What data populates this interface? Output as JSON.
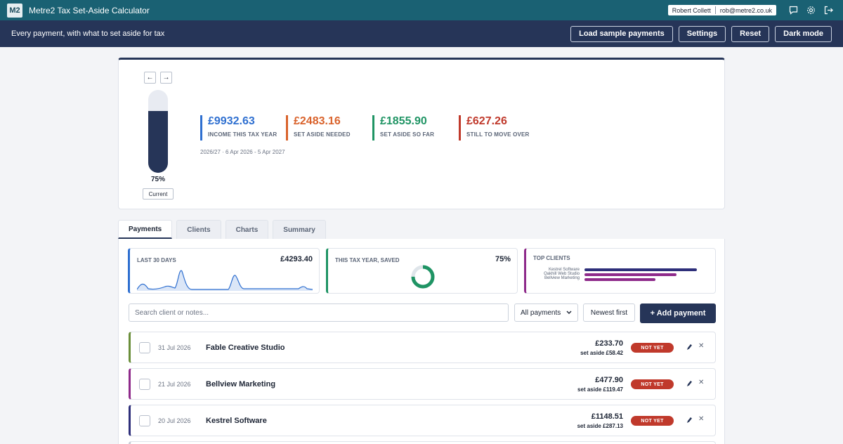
{
  "app": {
    "logo": "M2",
    "title": "Metre2 Tax Set-Aside Calculator"
  },
  "user": {
    "name": "Robert Collett",
    "email": "rob@metre2.co.uk"
  },
  "top_icons": [
    "chat-icon",
    "gear-icon",
    "logout-icon"
  ],
  "subbar": {
    "tagline": "Every payment, with what to set aside for tax",
    "buttons": [
      "Load sample payments",
      "Settings",
      "Reset",
      "Dark mode"
    ]
  },
  "hero": {
    "prev": "←",
    "next": "→",
    "jar_fraction": 0.75,
    "jar_label": "75%",
    "current_label": "Current",
    "stats": [
      {
        "value": "£9932.63",
        "label": "INCOME THIS TAX YEAR",
        "color": "#2e6fd0"
      },
      {
        "value": "£2483.16",
        "label": "SET ASIDE NEEDED",
        "color": "#d9622b"
      },
      {
        "value": "£1855.90",
        "label": "SET ASIDE SO FAR",
        "color": "#1f9464"
      },
      {
        "value": "£627.26",
        "label": "STILL TO MOVE OVER",
        "color": "#c0392b"
      }
    ],
    "period": "2026/27 · 6 Apr 2026 - 5 Apr 2027"
  },
  "tabs": [
    "Payments",
    "Clients",
    "Charts",
    "Summary"
  ],
  "cards": {
    "last30": {
      "title": "LAST 30 DAYS",
      "value": "£4293.40",
      "color": "#2e6fd0"
    },
    "saved": {
      "title": "THIS TAX YEAR, SAVED",
      "value": "75%",
      "fraction": 0.75,
      "color": "#1f9464"
    },
    "top_clients": {
      "title": "TOP CLIENTS",
      "color": "#8e2a8a",
      "clients": [
        {
          "name": "Kestrel Software",
          "share": 1.0,
          "color": "#2e2f7a"
        },
        {
          "name": "Oakhill Web Studio",
          "share": 0.82,
          "color": "#8e2a8a"
        },
        {
          "name": "Bellview Marketing",
          "share": 0.63,
          "color": "#8e2a8a"
        }
      ]
    }
  },
  "toolbar": {
    "search_placeholder": "Search client or notes...",
    "filter": "All payments",
    "sort": "Newest first",
    "add": "+ Add payment"
  },
  "payments": [
    {
      "date": "31 Jul 2026",
      "client": "Fable Creative Studio",
      "amount": "£233.70",
      "aside": "set aside £58.42",
      "status": "NOT YET",
      "color": "#6a8e3a"
    },
    {
      "date": "21 Jul 2026",
      "client": "Bellview Marketing",
      "amount": "£477.90",
      "aside": "set aside £119.47",
      "status": "NOT YET",
      "color": "#8e2a8a"
    },
    {
      "date": "20 Jul 2026",
      "client": "Kestrel Software",
      "amount": "£1148.51",
      "aside": "set aside £287.13",
      "status": "NOT YET",
      "color": "#2e2f7a"
    }
  ]
}
